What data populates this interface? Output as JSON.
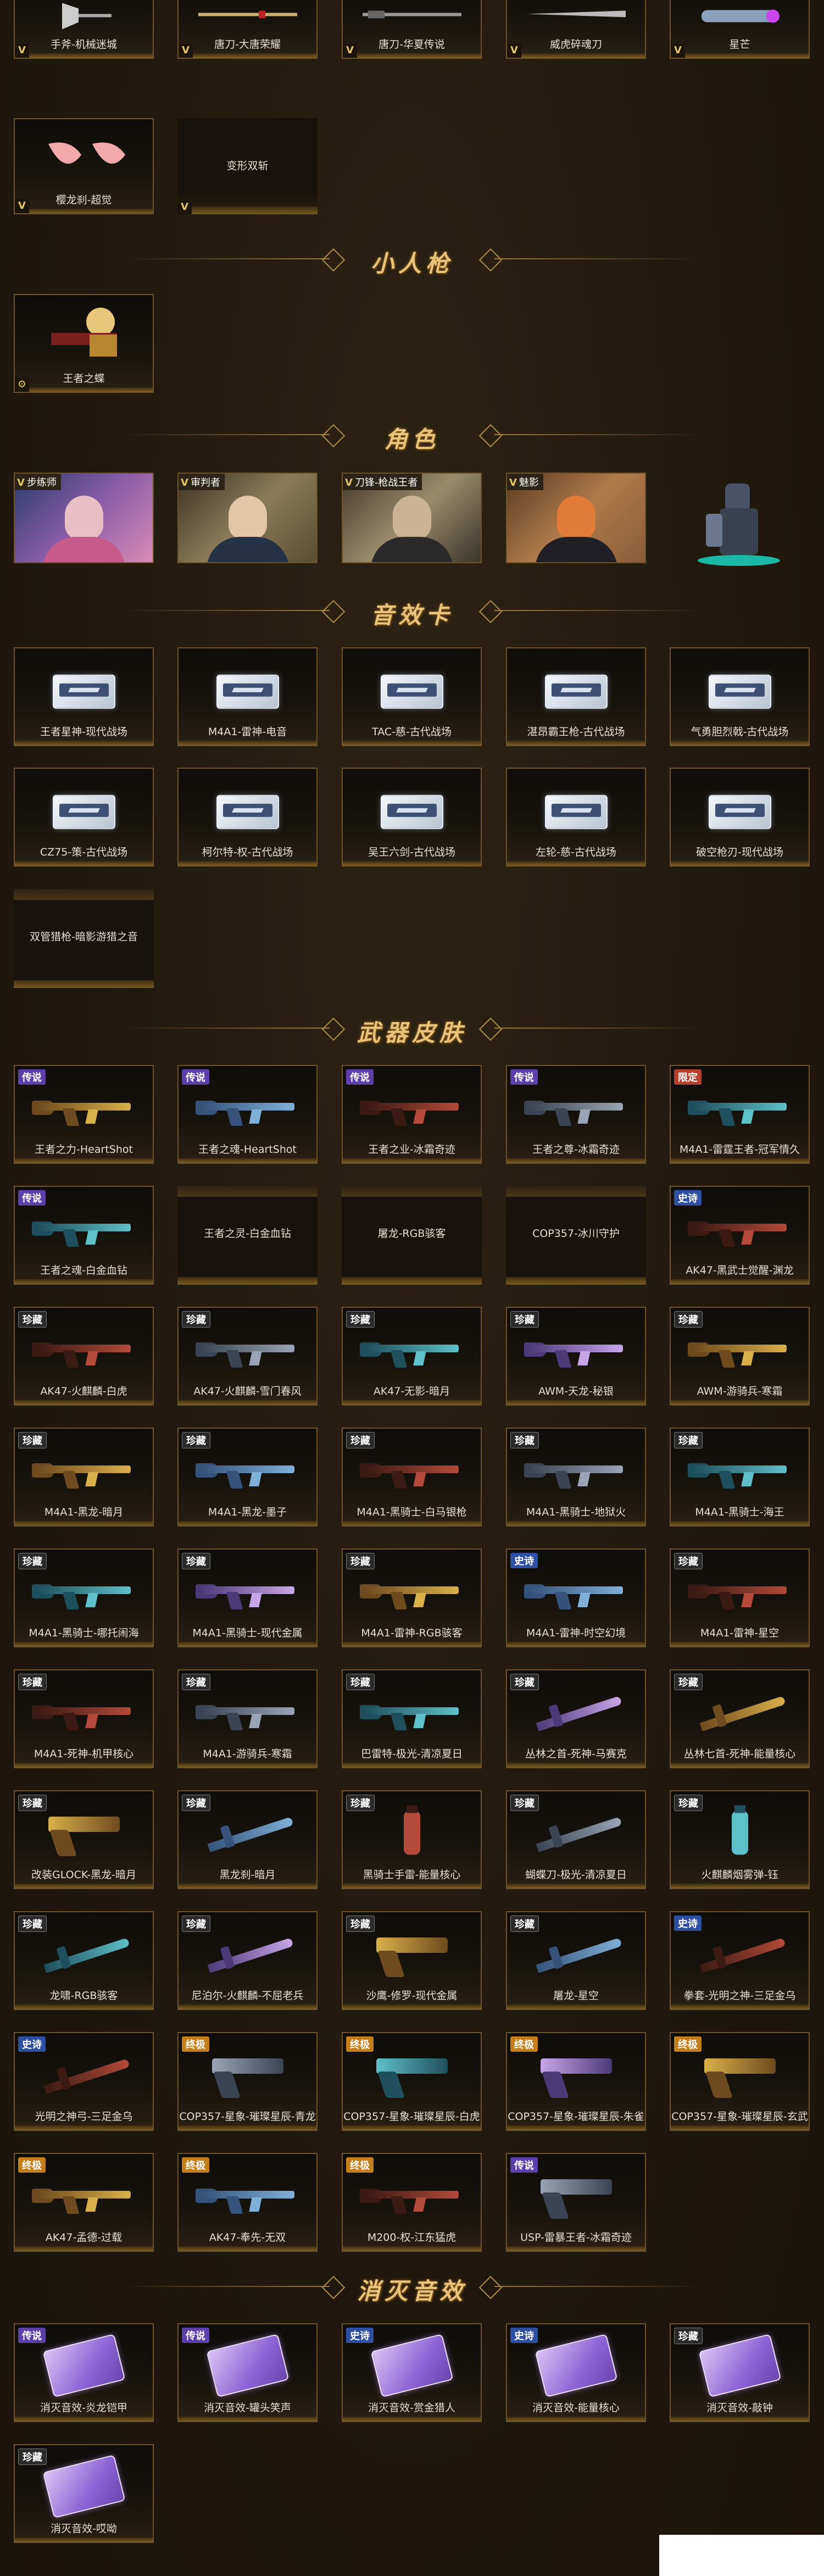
{
  "row0": [
    {
      "label": "手斧-机械迷城",
      "v": "V"
    },
    {
      "label": "唐刀-大唐荣耀",
      "v": "V"
    },
    {
      "label": "唐刀-华夏传说",
      "v": "V"
    },
    {
      "label": "威虎碎魂刀",
      "v": "V"
    },
    {
      "label": "星芒",
      "v": "V"
    }
  ],
  "row1": [
    {
      "label": "樱龙刹-超觉",
      "v": "V"
    },
    {
      "label": "变形双斩",
      "v": "V"
    }
  ],
  "section_mini": "小人枪",
  "mini_items": [
    {
      "label": "王者之蝶",
      "v": "⚙"
    }
  ],
  "section_role": "角色",
  "roles": [
    {
      "tag": "步练师",
      "v": "V"
    },
    {
      "tag": "审判者",
      "v": "V"
    },
    {
      "tag": "刀锋-枪战王者",
      "v": "V"
    },
    {
      "tag": "魅影",
      "v": "V"
    }
  ],
  "section_sfx": "音效卡",
  "sfx_row1": [
    "王者星神-现代战场",
    "M4A1-雷神-电音",
    "TAC-慈-古代战场",
    "湛昂霸王枪-古代战场",
    "气勇胆烈戟-古代战场"
  ],
  "sfx_row2": [
    "CZ75-策-古代战场",
    "柯尔特-权-古代战场",
    "吴王六剑-古代战场",
    "左轮-慈-古代战场",
    "破空枪刃-现代战场"
  ],
  "sfx_row3": [
    "双管猎枪-暗影游猎之音"
  ],
  "section_weapon": "武器皮肤",
  "badges": {
    "legend": "传说",
    "limited": "限定",
    "epic": "史诗",
    "rare": "珍藏",
    "ultimate": "终极"
  },
  "w_row1": [
    {
      "label": "王者之力-HeartShot",
      "badge": "传说"
    },
    {
      "label": "王者之魂-HeartShot",
      "badge": "传说"
    },
    {
      "label": "王者之业-冰霜奇迹",
      "badge": "传说"
    },
    {
      "label": "王者之尊-冰霜奇迹",
      "badge": "传说"
    },
    {
      "label": "M4A1-雷霆王者-冠军情久",
      "badge": "限定"
    }
  ],
  "w_row2": [
    {
      "label": "王者之魂-白金血钻",
      "badge": "传说"
    },
    {
      "label": "王者之灵-白金血钻",
      "badge": ""
    },
    {
      "label": "屠龙-RGB骇客",
      "badge": ""
    },
    {
      "label": "COP357-冰川守护",
      "badge": ""
    },
    {
      "label": "AK47-黑武士觉醒-渊龙",
      "badge": "史诗"
    }
  ],
  "w_row3": [
    {
      "label": "AK47-火麒麟-白虎",
      "badge": "珍藏"
    },
    {
      "label": "AK47-火麒麟-雪门春风",
      "badge": "珍藏"
    },
    {
      "label": "AK47-无影-暗月",
      "badge": "珍藏"
    },
    {
      "label": "AWM-天龙-秘银",
      "badge": "珍藏"
    },
    {
      "label": "AWM-游骑兵-寒霜",
      "badge": "珍藏"
    }
  ],
  "w_row4": [
    {
      "label": "M4A1-黑龙-暗月",
      "badge": "珍藏"
    },
    {
      "label": "M4A1-黑龙-墨子",
      "badge": "珍藏"
    },
    {
      "label": "M4A1-黑骑士-白马银枪",
      "badge": "珍藏"
    },
    {
      "label": "M4A1-黑骑士-地狱火",
      "badge": "珍藏"
    },
    {
      "label": "M4A1-黑骑士-海王",
      "badge": "珍藏"
    }
  ],
  "w_row5": [
    {
      "label": "M4A1-黑骑士-哪托闹海",
      "badge": "珍藏"
    },
    {
      "label": "M4A1-黑骑士-现代金属",
      "badge": "珍藏"
    },
    {
      "label": "M4A1-雷神-RGB骇客",
      "badge": "珍藏"
    },
    {
      "label": "M4A1-雷神-时空幻境",
      "badge": "史诗"
    },
    {
      "label": "M4A1-雷神-星空",
      "badge": "珍藏"
    }
  ],
  "w_row6": [
    {
      "label": "M4A1-死神-机甲核心",
      "badge": "珍藏"
    },
    {
      "label": "M4A1-游骑兵-寒霜",
      "badge": "珍藏"
    },
    {
      "label": "巴雷特-极光-清凉夏日",
      "badge": "珍藏"
    },
    {
      "label": "丛林之首-死神-马赛克",
      "badge": "珍藏"
    },
    {
      "label": "丛林七首-死神-能量核心",
      "badge": "珍藏"
    }
  ],
  "w_row7": [
    {
      "label": "改装GLOCK-黑龙-暗月",
      "badge": "珍藏"
    },
    {
      "label": "黑龙刹-暗月",
      "badge": "珍藏"
    },
    {
      "label": "黑骑士手雷-能量核心",
      "badge": "珍藏"
    },
    {
      "label": "蝴蝶刀-极光-清凉夏日",
      "badge": "珍藏"
    },
    {
      "label": "火麒麟烟雾弹-钰",
      "badge": "珍藏"
    }
  ],
  "w_row8": [
    {
      "label": "龙啸-RGB骇客",
      "badge": "珍藏"
    },
    {
      "label": "尼泊尔-火麒麟-不屈老兵",
      "badge": "珍藏"
    },
    {
      "label": "沙鹰-修罗-现代金属",
      "badge": "珍藏"
    },
    {
      "label": "屠龙-星空",
      "badge": "珍藏"
    },
    {
      "label": "拳套-光明之神-三足金乌",
      "badge": "史诗"
    }
  ],
  "w_row9": [
    {
      "label": "光明之神弓-三足金乌",
      "badge": "史诗"
    },
    {
      "label": "COP357-星象-璀璨星辰-青龙",
      "badge": "终极"
    },
    {
      "label": "COP357-星象-璀璨星辰-白虎",
      "badge": "终极"
    },
    {
      "label": "COP357-星象-璀璨星辰-朱雀",
      "badge": "终极"
    },
    {
      "label": "COP357-星象-璀璨星辰-玄武",
      "badge": "终极"
    }
  ],
  "w_row10": [
    {
      "label": "AK47-孟德-过载",
      "badge": "终极"
    },
    {
      "label": "AK47-奉先-无双",
      "badge": "终极"
    },
    {
      "label": "M200-权-江东猛虎",
      "badge": "终极"
    },
    {
      "label": "USP-雷暴王者-冰霜奇迹",
      "badge": "传说"
    }
  ],
  "section_kill": "消灭音效",
  "k_row1": [
    {
      "label": "消灭音效-炎龙铠甲",
      "badge": "传说"
    },
    {
      "label": "消灭音效-罐头笑声",
      "badge": "传说"
    },
    {
      "label": "消灭音效-赏金猎人",
      "badge": "史诗"
    },
    {
      "label": "消灭音效-能量核心",
      "badge": "史诗"
    },
    {
      "label": "消灭音效-敲钟",
      "badge": "珍藏"
    }
  ],
  "k_row2": [
    {
      "label": "消灭音效-哎呦",
      "badge": "珍藏"
    }
  ],
  "colors": {
    "accent": "#e8c37a",
    "border": "#6e5228",
    "legend": "#5c3fa8",
    "limited": "#b8402e",
    "epic": "#2f4fa3",
    "ultimate": "#c47f1a"
  }
}
